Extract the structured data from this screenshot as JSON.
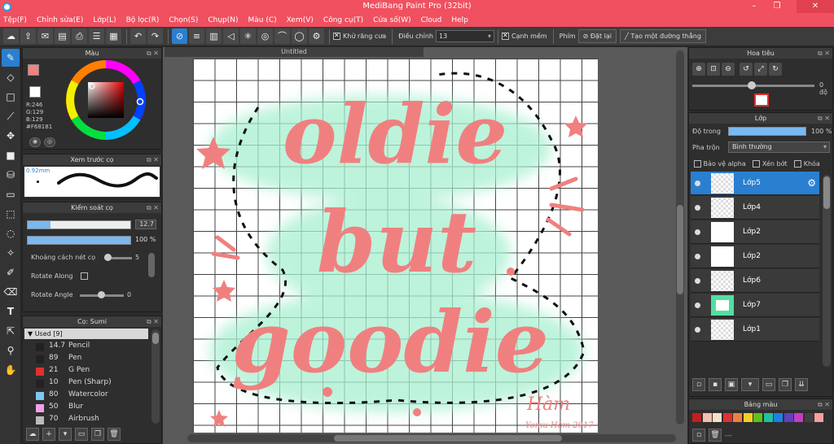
{
  "app": {
    "title": "MediBang Paint Pro (32bit)"
  },
  "menu": [
    "Tệp(F)",
    "Chỉnh sửa(E)",
    "Lớp(L)",
    "Bộ lọc(R)",
    "Chọn(S)",
    "Chụp(N)",
    "Màu (C)",
    "Xem(V)",
    "Công cụ(T)",
    "Cửa số(W)",
    "Cloud",
    "Help"
  ],
  "toolbar": {
    "antialias_label": "Khử răng cưa",
    "adjust_label": "Điều chỉnh",
    "adjust_value": "13",
    "edge_label": "Cạnh mềm",
    "key_label": "Phím",
    "reset_label": "Đặt lại",
    "straight_label": "Tạo một đường thẳng"
  },
  "panels": {
    "color": {
      "title": "Màu",
      "r": "R:246",
      "g": "G:129",
      "b": "B:129",
      "hex": "#F68181",
      "primary_color": "#f68181",
      "secondary_color": "#ffffff"
    },
    "brush_preview": {
      "title": "Xem trước cọ",
      "size": "0.92mm"
    },
    "brush_control": {
      "title": "Kiểm soát cọ",
      "size_value": "12.7",
      "size_fraction": 0.22,
      "opacity_value": "100 %",
      "opacity_fraction": 1.0,
      "spacing_label": "Khoảng cách nét cọ",
      "spacing_value": "5",
      "rotate_along_label": "Rotate Along",
      "rotate_angle_label": "Rotate Angle",
      "rotate_angle_value": "0"
    },
    "brush_list": {
      "title": "Cọ: Sumi",
      "group": "Used [9]",
      "items": [
        {
          "size": "14.7",
          "name": "Pencil",
          "color": "#222222"
        },
        {
          "size": "89",
          "name": "Pen",
          "color": "#222222"
        },
        {
          "size": "21",
          "name": "G Pen",
          "color": "#e03030"
        },
        {
          "size": "10",
          "name": "Pen (Sharp)",
          "color": "#222222"
        },
        {
          "size": "80",
          "name": "Watercolor",
          "color": "#7cc8f0"
        },
        {
          "size": "50",
          "name": "Blur",
          "color": "#f0a0e8"
        },
        {
          "size": "70",
          "name": "Airbrush",
          "color": "#bbbbbb"
        }
      ]
    },
    "navigator": {
      "title": "Hoa tiêu",
      "rotation": "0 độ"
    },
    "layers": {
      "title": "Lớp",
      "opacity_label": "Độ trong",
      "opacity_value": "100 %",
      "opacity_fraction": 1.0,
      "blend_label": "Pha trộn",
      "blend_value": "Bình thường",
      "protect_alpha": "Bảo vệ alpha",
      "clipping": "Xén bớt",
      "lock": "Khóa",
      "items": [
        {
          "name": "Lớp5",
          "selected": true
        },
        {
          "name": "Lớp4",
          "selected": false
        },
        {
          "name": "Lớp2",
          "selected": false
        },
        {
          "name": "Lớp2",
          "selected": false
        },
        {
          "name": "Lớp6",
          "selected": false
        },
        {
          "name": "Lớp7",
          "selected": false
        },
        {
          "name": "Lớp1",
          "selected": false
        }
      ]
    },
    "palette": {
      "title": "Bảng màu",
      "colors": [
        "#c02020",
        "#f0c0b0",
        "#f8e0c8",
        "#e03030",
        "#f08040",
        "#f0d020",
        "#60c020",
        "#20c0a0",
        "#2080e0",
        "#6040c0",
        "#c040c0",
        "#404040",
        "#f8a0a0"
      ]
    }
  },
  "document": {
    "tab": "Untitled"
  },
  "artwork": {
    "lines": [
      "oldie",
      "but",
      "goodie"
    ],
    "signature": "Hàm",
    "signature_sub": "Yomu Hàm 2017"
  }
}
